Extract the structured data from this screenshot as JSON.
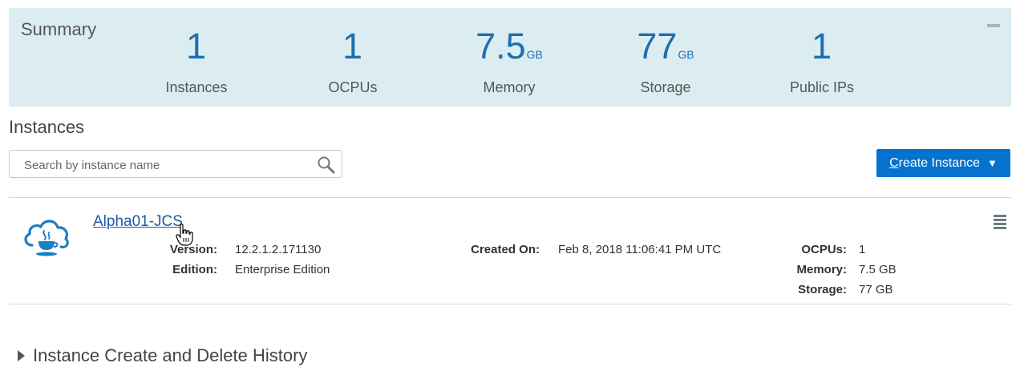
{
  "summary": {
    "title": "Summary",
    "metrics": [
      {
        "value": "1",
        "unit": "",
        "label": "Instances"
      },
      {
        "value": "1",
        "unit": "",
        "label": "OCPUs"
      },
      {
        "value": "7.5",
        "unit": "GB",
        "label": "Memory"
      },
      {
        "value": "77",
        "unit": "GB",
        "label": "Storage"
      },
      {
        "value": "1",
        "unit": "",
        "label": "Public IPs"
      }
    ]
  },
  "instances": {
    "title": "Instances",
    "search_placeholder": "Search by instance name",
    "create_button": {
      "label_underlined": "C",
      "label_rest": "reate Instance",
      "caret": "▼"
    }
  },
  "instance": {
    "name": "Alpha01-JCS",
    "fields": {
      "version_label": "Version:",
      "version": "12.2.1.2.171130",
      "edition_label": "Edition:",
      "edition": "Enterprise Edition",
      "created_label": "Created On:",
      "created": "Feb 8, 2018 11:06:41 PM UTC",
      "ocpus_label": "OCPUs:",
      "ocpus": "1",
      "memory_label": "Memory:",
      "memory": "7.5 GB",
      "storage_label": "Storage:",
      "storage": "77 GB"
    }
  },
  "history": {
    "title": "Instance Create and Delete History"
  },
  "colors": {
    "accent": "#0572ce",
    "summary_bg": "#dcedf2",
    "metric": "#1c6fb0",
    "link": "#1a5aa6"
  },
  "icons": [
    "collapse-icon",
    "search-icon",
    "caret-down-icon",
    "cloud-java-icon",
    "hand-cursor-icon",
    "menu-icon",
    "expand-triangle-icon"
  ]
}
